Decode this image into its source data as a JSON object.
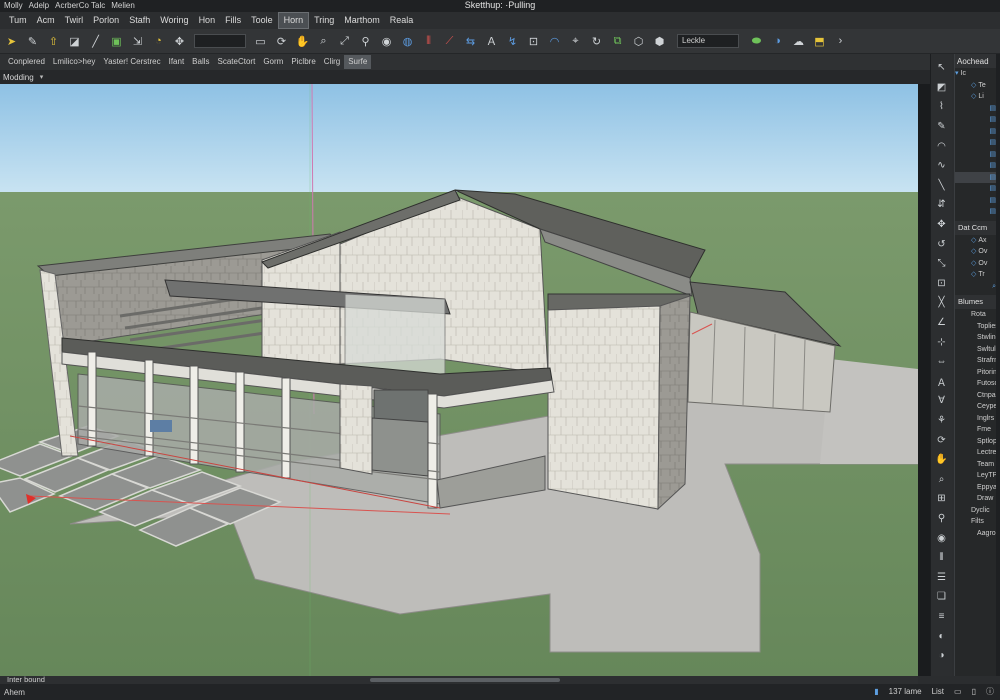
{
  "window": {
    "title": "Sketthup: ·Pulling"
  },
  "menu": [
    {
      "label": "Molly"
    },
    {
      "label": "Adelp"
    },
    {
      "label": "AcrberCo Talc"
    },
    {
      "label": "Melien"
    }
  ],
  "menu2": [
    {
      "label": "Tum"
    },
    {
      "label": "Acm"
    },
    {
      "label": "Twirl"
    },
    {
      "label": "Porlon"
    },
    {
      "label": "Stafh"
    },
    {
      "label": "Woring"
    },
    {
      "label": "Hon"
    },
    {
      "label": "Fills"
    },
    {
      "label": "Toole"
    },
    {
      "label": "Horn"
    },
    {
      "label": "Tring"
    },
    {
      "label": "Marthom"
    },
    {
      "label": "Reala"
    }
  ],
  "toolbar": {
    "field_value": "",
    "layer_value": "Leckle"
  },
  "tabs": [
    {
      "label": "Conplered"
    },
    {
      "label": "Lmilico>hey"
    },
    {
      "label": "Yaster! Cerstrec"
    },
    {
      "label": "Ifant"
    },
    {
      "label": "Balls"
    },
    {
      "label": "ScateCtort"
    },
    {
      "label": "Gorm"
    },
    {
      "label": "Piclbre"
    },
    {
      "label": "Clirg"
    },
    {
      "label": "Surfe"
    }
  ],
  "mode": {
    "label": "Modding"
  },
  "panel": {
    "header": "Aochead",
    "tree_top": [
      {
        "label": "Ic"
      },
      {
        "label": "Te"
      },
      {
        "label": "Li"
      }
    ],
    "section2": "Dat Ccm",
    "section2_items": [
      {
        "label": "Ax"
      },
      {
        "label": "Ov"
      },
      {
        "label": "Ov"
      },
      {
        "label": "Tr"
      }
    ],
    "section3": "Blumes",
    "section3_items": [
      {
        "label": "Rota"
      },
      {
        "label": "Toplies"
      },
      {
        "label": "Stwling"
      },
      {
        "label": "Swltule"
      },
      {
        "label": "Strafrn"
      },
      {
        "label": "Pitoring"
      },
      {
        "label": "Futosore"
      },
      {
        "label": "Ctnpain"
      },
      {
        "label": "Ceypes"
      },
      {
        "label": "Inglrs"
      },
      {
        "label": "Fme"
      },
      {
        "label": "Sptlop"
      },
      {
        "label": "Lectres"
      },
      {
        "label": "Team In"
      },
      {
        "label": "LeyTPat"
      },
      {
        "label": "Eppyalf"
      },
      {
        "label": "Draw"
      },
      {
        "label": "Dyclic"
      },
      {
        "label": "Filts"
      },
      {
        "label": "Aagron"
      }
    ]
  },
  "status": {
    "hint": "Inter bound",
    "left": "Ahem",
    "coords": "137 lame",
    "scale": "List"
  },
  "colors": {
    "ground": "#6f9062",
    "sky": "#a8d2ee",
    "slab": "#bdbcb8",
    "roof": "#6a6c66",
    "accent": "#d9534f"
  }
}
